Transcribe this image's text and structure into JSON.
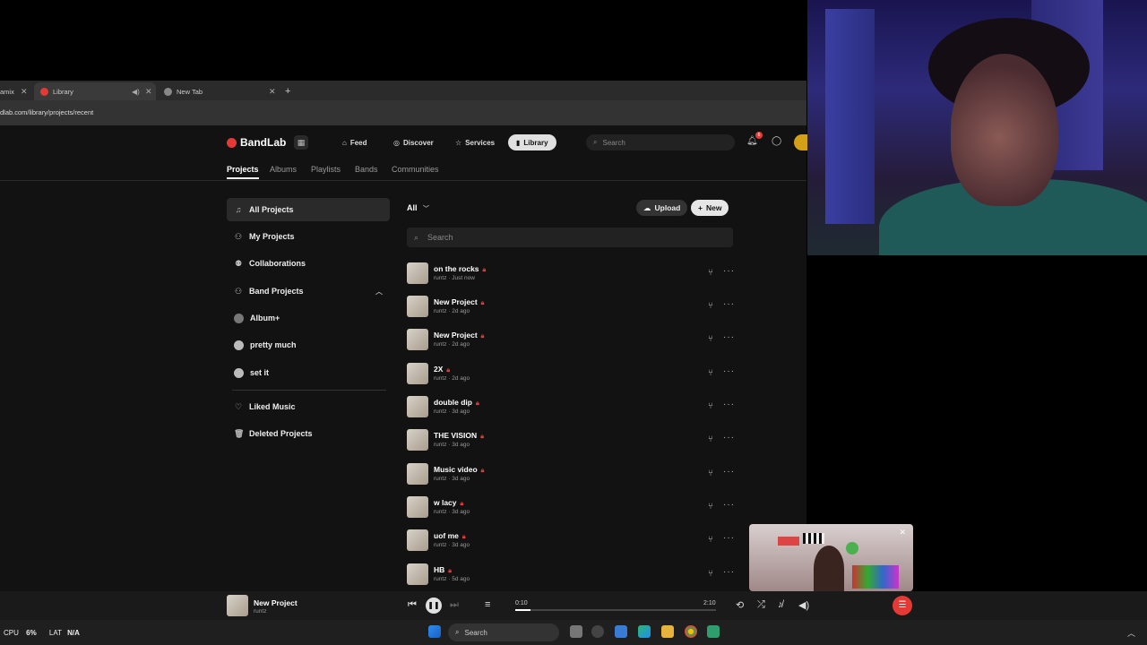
{
  "browser": {
    "tabs": [
      {
        "label": "",
        "fragment": "amix"
      },
      {
        "label": "Library"
      },
      {
        "label": "New Tab"
      }
    ],
    "new_tab": "+",
    "url": "dlab.com/library/projects/recent"
  },
  "app": {
    "logo": "BandLab",
    "nav": [
      {
        "label": "Feed"
      },
      {
        "label": "Discover"
      },
      {
        "label": "Services"
      },
      {
        "label": "Library"
      }
    ],
    "search_placeholder": "Search",
    "notif_count": "6",
    "subnav": [
      "Projects",
      "Albums",
      "Playlists",
      "Bands",
      "Communities"
    ]
  },
  "sidebar": {
    "items": [
      {
        "label": "All Projects",
        "icon": "music-note-icon"
      },
      {
        "label": "My Projects",
        "icon": "person-icon"
      },
      {
        "label": "Collaborations",
        "icon": "people-icon"
      },
      {
        "label": "Band Projects",
        "icon": "band-icon"
      },
      {
        "label": "Album+",
        "icon": "album-icon"
      },
      {
        "label": "pretty much",
        "icon": "dot-icon"
      },
      {
        "label": "set it",
        "icon": "dot-icon"
      },
      {
        "label": "Liked Music",
        "icon": "heart-icon"
      },
      {
        "label": "Deleted Projects",
        "icon": "trash-icon"
      }
    ]
  },
  "main": {
    "filter": "All",
    "upload": "Upload",
    "new": "New",
    "search_placeholder": "Search",
    "projects": [
      {
        "title": "on the rocks",
        "artist": "runtz",
        "time": "Just now"
      },
      {
        "title": "New Project",
        "artist": "runtz",
        "time": "2d ago"
      },
      {
        "title": "New Project",
        "artist": "runtz",
        "time": "2d ago"
      },
      {
        "title": "2X",
        "artist": "runtz",
        "time": "2d ago"
      },
      {
        "title": "double dip",
        "artist": "runtz",
        "time": "3d ago"
      },
      {
        "title": "THE VISION",
        "artist": "runtz",
        "time": "3d ago"
      },
      {
        "title": "Music video",
        "artist": "runtz",
        "time": "3d ago"
      },
      {
        "title": "w lacy",
        "artist": "runtz",
        "time": "3d ago"
      },
      {
        "title": "uof me",
        "artist": "runtz",
        "time": "3d ago"
      },
      {
        "title": "HB",
        "artist": "runtz",
        "time": "5d ago"
      }
    ]
  },
  "player": {
    "title": "New Project",
    "artist": "runtz",
    "elapsed": "0:10",
    "duration": "2:10",
    "progress": 0.077
  },
  "taskbar": {
    "cpu_label": "CPU",
    "cpu_value": "6%",
    "lat_label": "LAT",
    "lat_value": "N/A",
    "search": "Search"
  },
  "colors": {
    "accent": "#e53935",
    "background": "#121212"
  }
}
